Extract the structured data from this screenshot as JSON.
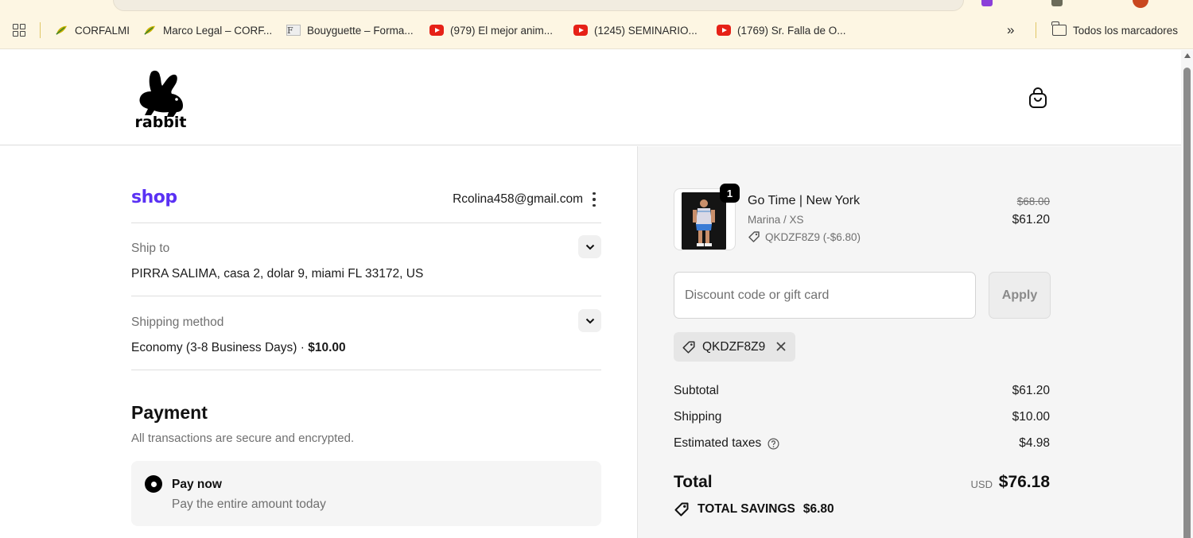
{
  "bookmarks": {
    "items": [
      {
        "label": "CORFALMI",
        "icon": "leaf-icon"
      },
      {
        "label": "Marco Legal – CORF...",
        "icon": "leaf-icon"
      },
      {
        "label": "Bouyguette – Forma...",
        "icon": "document-icon"
      },
      {
        "label": "(979) El mejor anim...",
        "icon": "youtube-icon"
      },
      {
        "label": "(1245) SEMINARIO...",
        "icon": "youtube-icon"
      },
      {
        "label": "(1769) Sr. Falla de O...",
        "icon": "youtube-icon"
      }
    ],
    "overflow_label": "»",
    "all_bookmarks_label": "Todos los marcadores"
  },
  "store": {
    "logo_text": "rabbit",
    "cart_icon": "shopping-bag-icon"
  },
  "checkout": {
    "shop_brand": "shop",
    "email": "Rcolina458@gmail.com",
    "ship_to": {
      "label": "Ship to",
      "value": "PIRRA SALIMA, casa 2, dolar 9, miami FL 33172, US"
    },
    "shipping_method": {
      "label": "Shipping method",
      "value": "Economy (3-8 Business Days) · ",
      "price": "$10.00"
    },
    "payment": {
      "title": "Payment",
      "subtitle": "All transactions are secure and encrypted.",
      "option_title": "Pay now",
      "option_subtitle": "Pay the entire amount today"
    }
  },
  "summary": {
    "item": {
      "quantity": "1",
      "name": "Go Time | New York",
      "variant": "Marina / XS",
      "discount": "QKDZF8Z9 (-$6.80)",
      "original_price": "$68.00",
      "price": "$61.20"
    },
    "discount_placeholder": "Discount code or gift card",
    "apply_label": "Apply",
    "applied_code": "QKDZF8Z9",
    "rows": [
      {
        "label": "Subtotal",
        "value": "$61.20"
      },
      {
        "label": "Shipping",
        "value": "$10.00"
      },
      {
        "label": "Estimated taxes",
        "value": "$4.98"
      }
    ],
    "total_label": "Total",
    "currency": "USD",
    "total": "$76.18",
    "savings_label": "TOTAL SAVINGS",
    "savings": "$6.80"
  },
  "colors": {
    "shop_brand": "#5a31f4",
    "panel_bg": "#f5f5f5",
    "bookmarks_bg": "#fdf6e3"
  }
}
